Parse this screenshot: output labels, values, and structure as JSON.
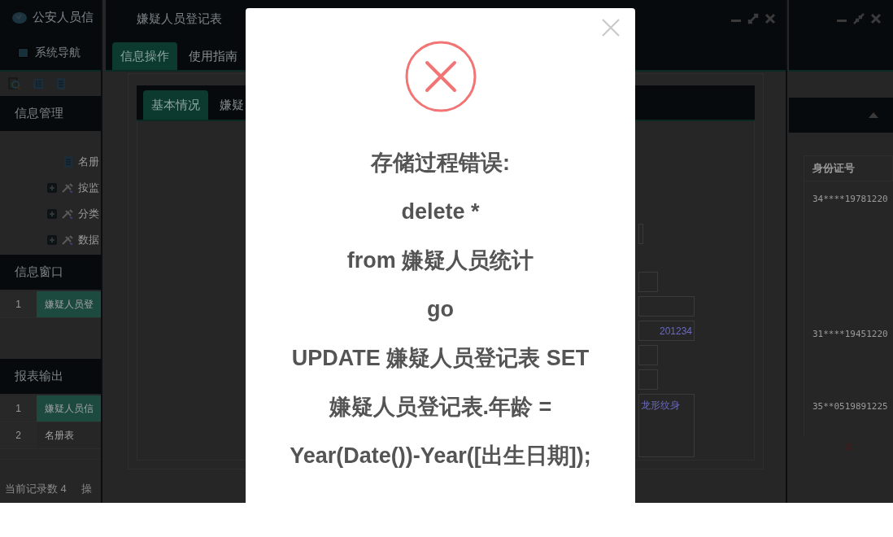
{
  "app_window": {
    "title": "公安人员信",
    "nav_tab": "系统导航",
    "panels": [
      {
        "title": "信息管理",
        "tree": [
          {
            "label": "名册",
            "kind": "doc"
          },
          {
            "label": "按监",
            "kind": "group",
            "expanded": false
          },
          {
            "label": "分类",
            "kind": "group",
            "expanded": false
          },
          {
            "label": "数据",
            "kind": "group",
            "expanded": false
          }
        ]
      },
      {
        "title": "信息窗口",
        "rows": [
          {
            "index": "1",
            "label": "嫌疑人员登",
            "selected": true
          }
        ]
      },
      {
        "title": "报表输出",
        "rows": [
          {
            "index": "1",
            "label": "嫌疑人员信",
            "selected": true
          },
          {
            "index": "2",
            "label": "名册表",
            "selected": false
          }
        ]
      }
    ],
    "footer": [
      "当前记录数 4",
      "操"
    ]
  },
  "form_window": {
    "title": "嫌疑人员登记表",
    "tabs": [
      {
        "label": "信息操作",
        "selected": true
      },
      {
        "label": "使用指南",
        "selected": false
      }
    ],
    "inner_tabs": [
      {
        "label": "基本情况",
        "selected": true
      },
      {
        "label": "嫌疑",
        "selected": false
      }
    ],
    "fields": [
      {
        "kind": "short"
      },
      {
        "kind": "medium"
      },
      {
        "kind": "long"
      },
      {
        "kind": "long",
        "value": "201234"
      },
      {
        "kind": "medium"
      },
      {
        "kind": "medium"
      },
      {
        "kind": "textarea",
        "value": "龙形纹身"
      }
    ]
  },
  "list_window": {
    "columns": [
      "身份证号"
    ],
    "rows": [
      {
        "id": "34****19781220"
      },
      {
        "id": "31****19451220"
      },
      {
        "id": "35**0519891225"
      }
    ]
  },
  "dialog": {
    "message_lines": [
      "存储过程错误:",
      "delete *",
      "from 嫌疑人员统计",
      "go",
      "UPDATE 嫌疑人员登记表 SET",
      "嫌疑人员登记表.年龄 =",
      "Year(Date())-Year([出生日期]);"
    ]
  }
}
